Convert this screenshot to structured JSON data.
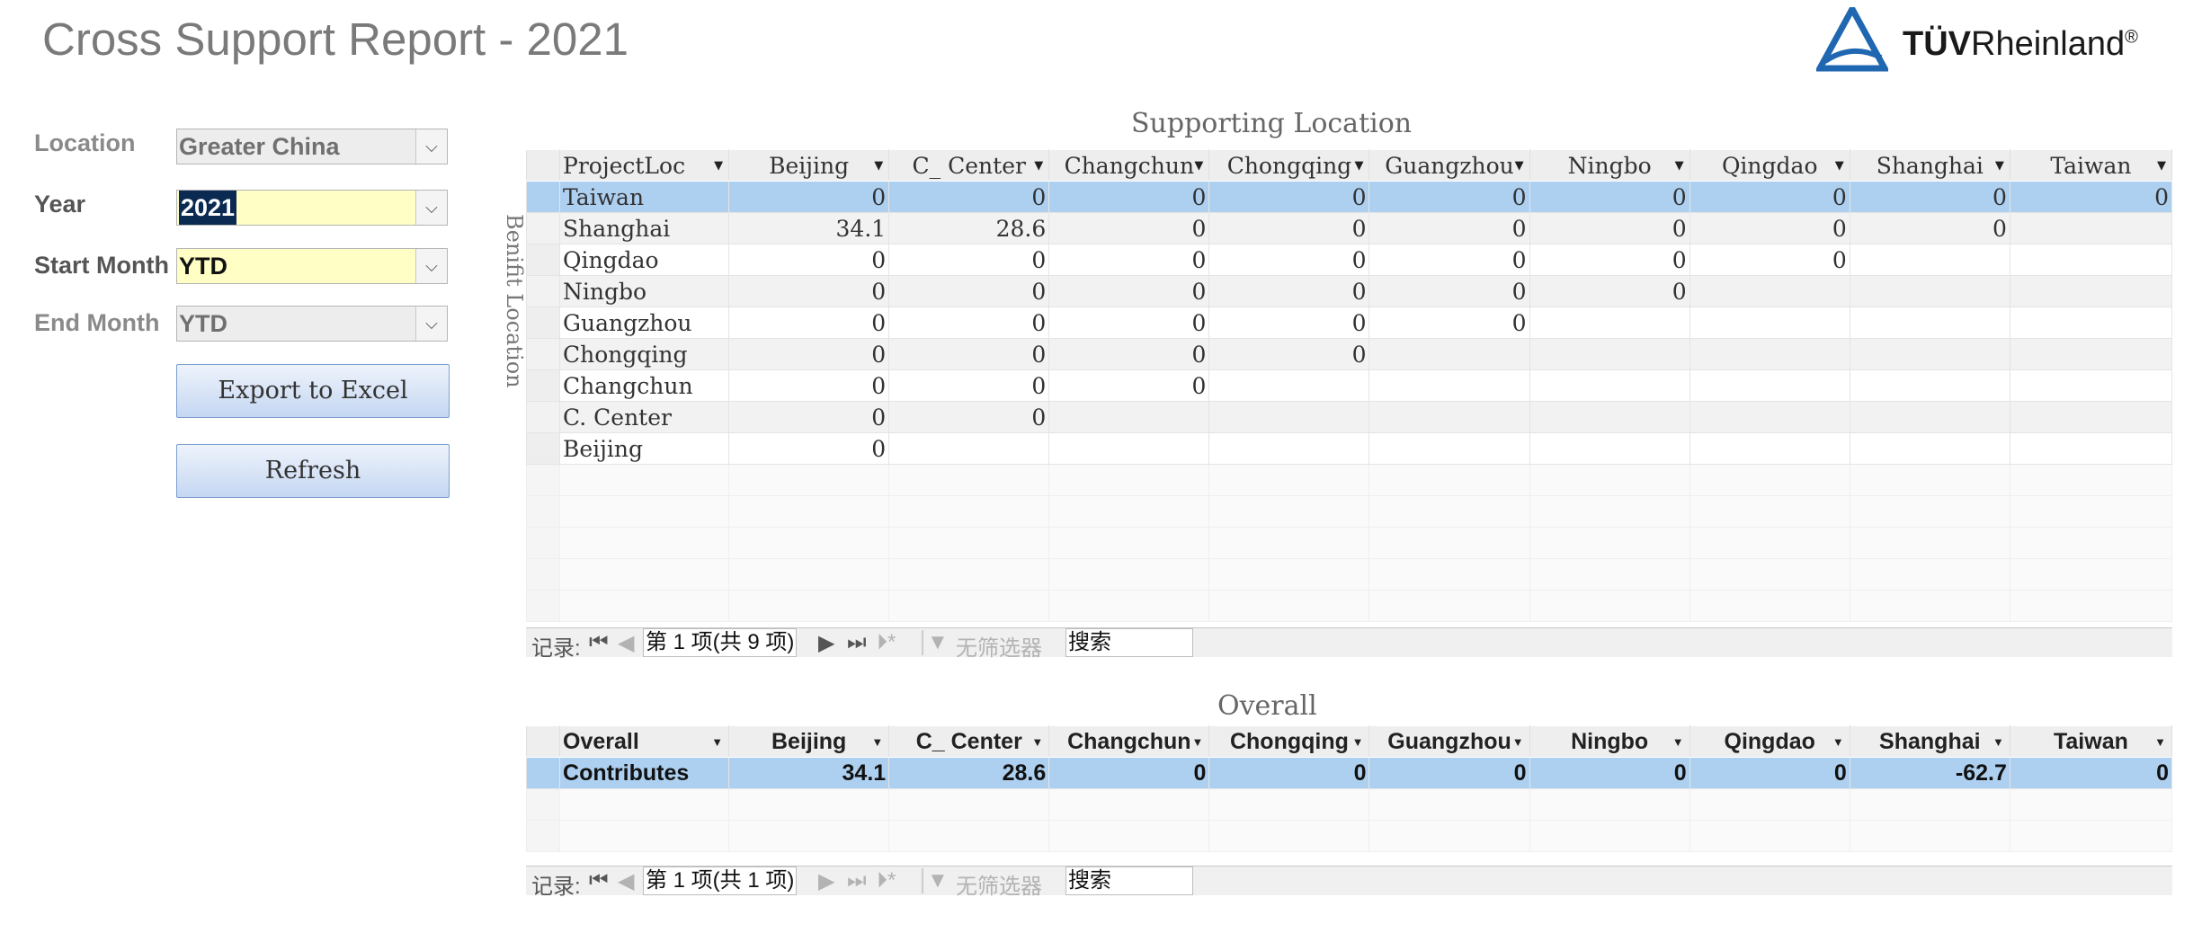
{
  "title": "Cross Support Report - 2021",
  "logo": {
    "prefix": "TÜV",
    "name": "Rheinland",
    "mark": "®",
    "color": "#1f67b1"
  },
  "filters": {
    "location": {
      "label": "Location",
      "value": "Greater China"
    },
    "year": {
      "label": "Year",
      "value": "2021"
    },
    "start_month": {
      "label": "Start Month",
      "value": "YTD"
    },
    "end_month": {
      "label": "End Month",
      "value": "YTD"
    }
  },
  "buttons": {
    "export": "Export to Excel",
    "refresh": "Refresh"
  },
  "supporting": {
    "title": "Supporting Location",
    "side_title": "Benifit Location",
    "columns": [
      "ProjectLoc",
      "Beijing",
      "C_ Center",
      "Changchun",
      "Chongqing",
      "Guangzhou",
      "Ningbo",
      "Qingdao",
      "Shanghai",
      "Taiwan"
    ],
    "rows": [
      [
        "Taiwan",
        "0",
        "0",
        "0",
        "0",
        "0",
        "0",
        "0",
        "0",
        "0"
      ],
      [
        "Shanghai",
        "34.1",
        "28.6",
        "0",
        "0",
        "0",
        "0",
        "0",
        "0",
        ""
      ],
      [
        "Qingdao",
        "0",
        "0",
        "0",
        "0",
        "0",
        "0",
        "0",
        "",
        ""
      ],
      [
        "Ningbo",
        "0",
        "0",
        "0",
        "0",
        "0",
        "0",
        "",
        "",
        ""
      ],
      [
        "Guangzhou",
        "0",
        "0",
        "0",
        "0",
        "0",
        "",
        "",
        "",
        ""
      ],
      [
        "Chongqing",
        "0",
        "0",
        "0",
        "0",
        "",
        "",
        "",
        "",
        ""
      ],
      [
        "Changchun",
        "0",
        "0",
        "0",
        "",
        "",
        "",
        "",
        "",
        ""
      ],
      [
        "C. Center",
        "0",
        "0",
        "",
        "",
        "",
        "",
        "",
        "",
        ""
      ],
      [
        "Beijing",
        "0",
        "",
        "",
        "",
        "",
        "",
        "",
        "",
        ""
      ]
    ],
    "nav": {
      "label": "记录:",
      "record": "第 1 项(共 9 项)",
      "filter": "无筛选器",
      "search": "搜索"
    }
  },
  "overall": {
    "title": "Overall",
    "columns": [
      "Overall",
      "Beijing",
      "C_ Center",
      "Changchun",
      "Chongqing",
      "Guangzhou",
      "Ningbo",
      "Qingdao",
      "Shanghai",
      "Taiwan"
    ],
    "rows": [
      [
        "Contributes",
        "34.1",
        "28.6",
        "0",
        "0",
        "0",
        "0",
        "0",
        "-62.7",
        "0"
      ]
    ],
    "nav": {
      "label": "记录:",
      "record": "第 1 项(共 1 项)",
      "filter": "无筛选器",
      "search": "搜索"
    }
  }
}
